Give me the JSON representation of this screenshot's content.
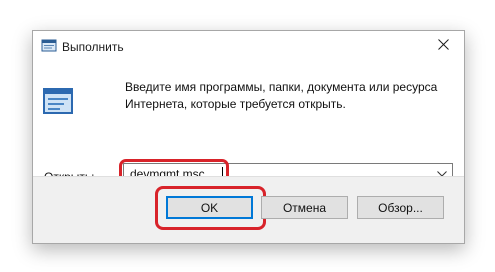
{
  "window": {
    "title": "Выполнить",
    "close_icon": "close-icon"
  },
  "content": {
    "description": "Введите имя программы, папки, документа или ресурса Интернета, которые требуется открыть.",
    "open_label": "Открыть:",
    "open_value": "devmgmt.msc"
  },
  "buttons": {
    "ok": "OK",
    "cancel": "Отмена",
    "browse": "Обзор..."
  },
  "colors": {
    "highlight": "#d8232a",
    "accent": "#0078d7"
  }
}
